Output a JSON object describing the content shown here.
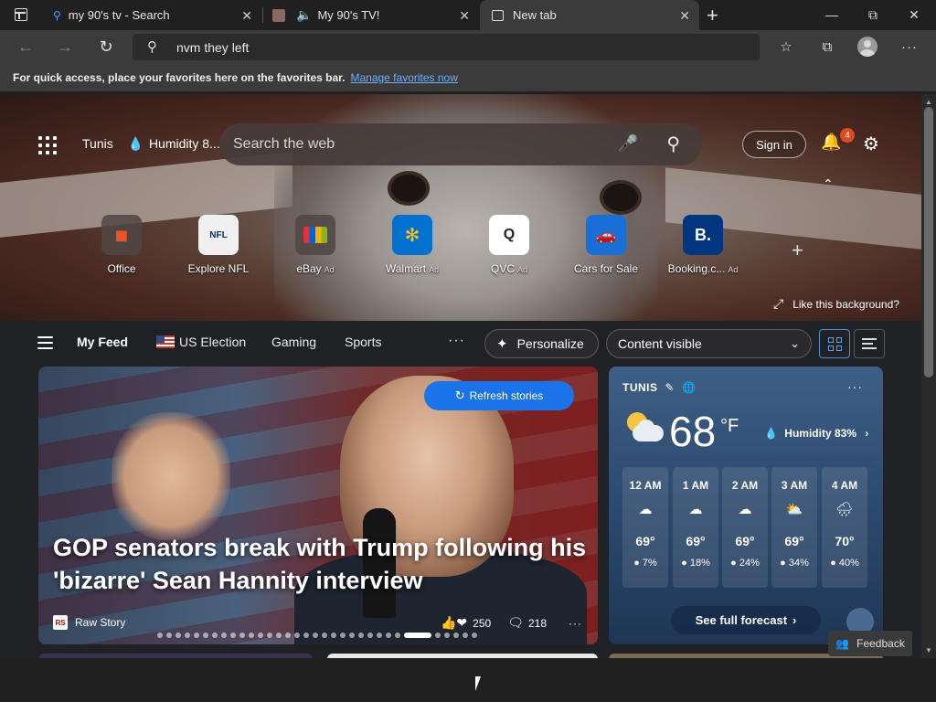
{
  "tabs": [
    {
      "title": "my 90's tv - Search"
    },
    {
      "title": "My 90's TV!"
    },
    {
      "title": "New tab"
    }
  ],
  "address_bar": {
    "value": "nvm they left"
  },
  "favorites_bar": {
    "text": "For quick access, place your favorites here on the favorites bar.",
    "link": "Manage favorites now"
  },
  "top": {
    "location": "Tunis",
    "humidity_short": "Humidity 8...",
    "search_placeholder": "Search the web",
    "sign_in": "Sign in",
    "notification_count": "4"
  },
  "tiles": [
    {
      "label": "Office",
      "ad": ""
    },
    {
      "label": "Explore NFL",
      "ad": ""
    },
    {
      "label": "eBay",
      "ad": "Ad"
    },
    {
      "label": "Walmart",
      "ad": "Ad"
    },
    {
      "label": "QVC",
      "ad": "Ad"
    },
    {
      "label": "Cars for Sale",
      "ad": ""
    },
    {
      "label": "Booking.c...",
      "ad": "Ad"
    }
  ],
  "like_bg": "Like this background?",
  "feed": {
    "tabs": [
      "My Feed",
      "US Election",
      "Gaming",
      "Sports"
    ],
    "personalize": "Personalize",
    "content_visible": "Content visible"
  },
  "story": {
    "refresh": "Refresh stories",
    "headline": "GOP senators break with Trump following his 'bizarre' Sean Hannity interview",
    "source": "Raw Story",
    "reactions": "250",
    "comments": "218",
    "carousel": {
      "total": 33,
      "active": 27
    }
  },
  "weather": {
    "city": "TUNIS",
    "temp": "68",
    "unit": "°F",
    "humidity": "Humidity 83%",
    "hours": [
      {
        "time": "12 AM",
        "temp": "69°",
        "precip": "7%"
      },
      {
        "time": "1 AM",
        "temp": "69°",
        "precip": "18%"
      },
      {
        "time": "2 AM",
        "temp": "69°",
        "precip": "24%"
      },
      {
        "time": "3 AM",
        "temp": "69°",
        "precip": "34%"
      },
      {
        "time": "4 AM",
        "temp": "70°",
        "precip": "40%"
      }
    ],
    "forecast": "See full forecast"
  },
  "feedback": "Feedback",
  "colors": {
    "accent": "#1a73e8",
    "badge": "#e04a1a",
    "link": "#6ab0ff"
  }
}
